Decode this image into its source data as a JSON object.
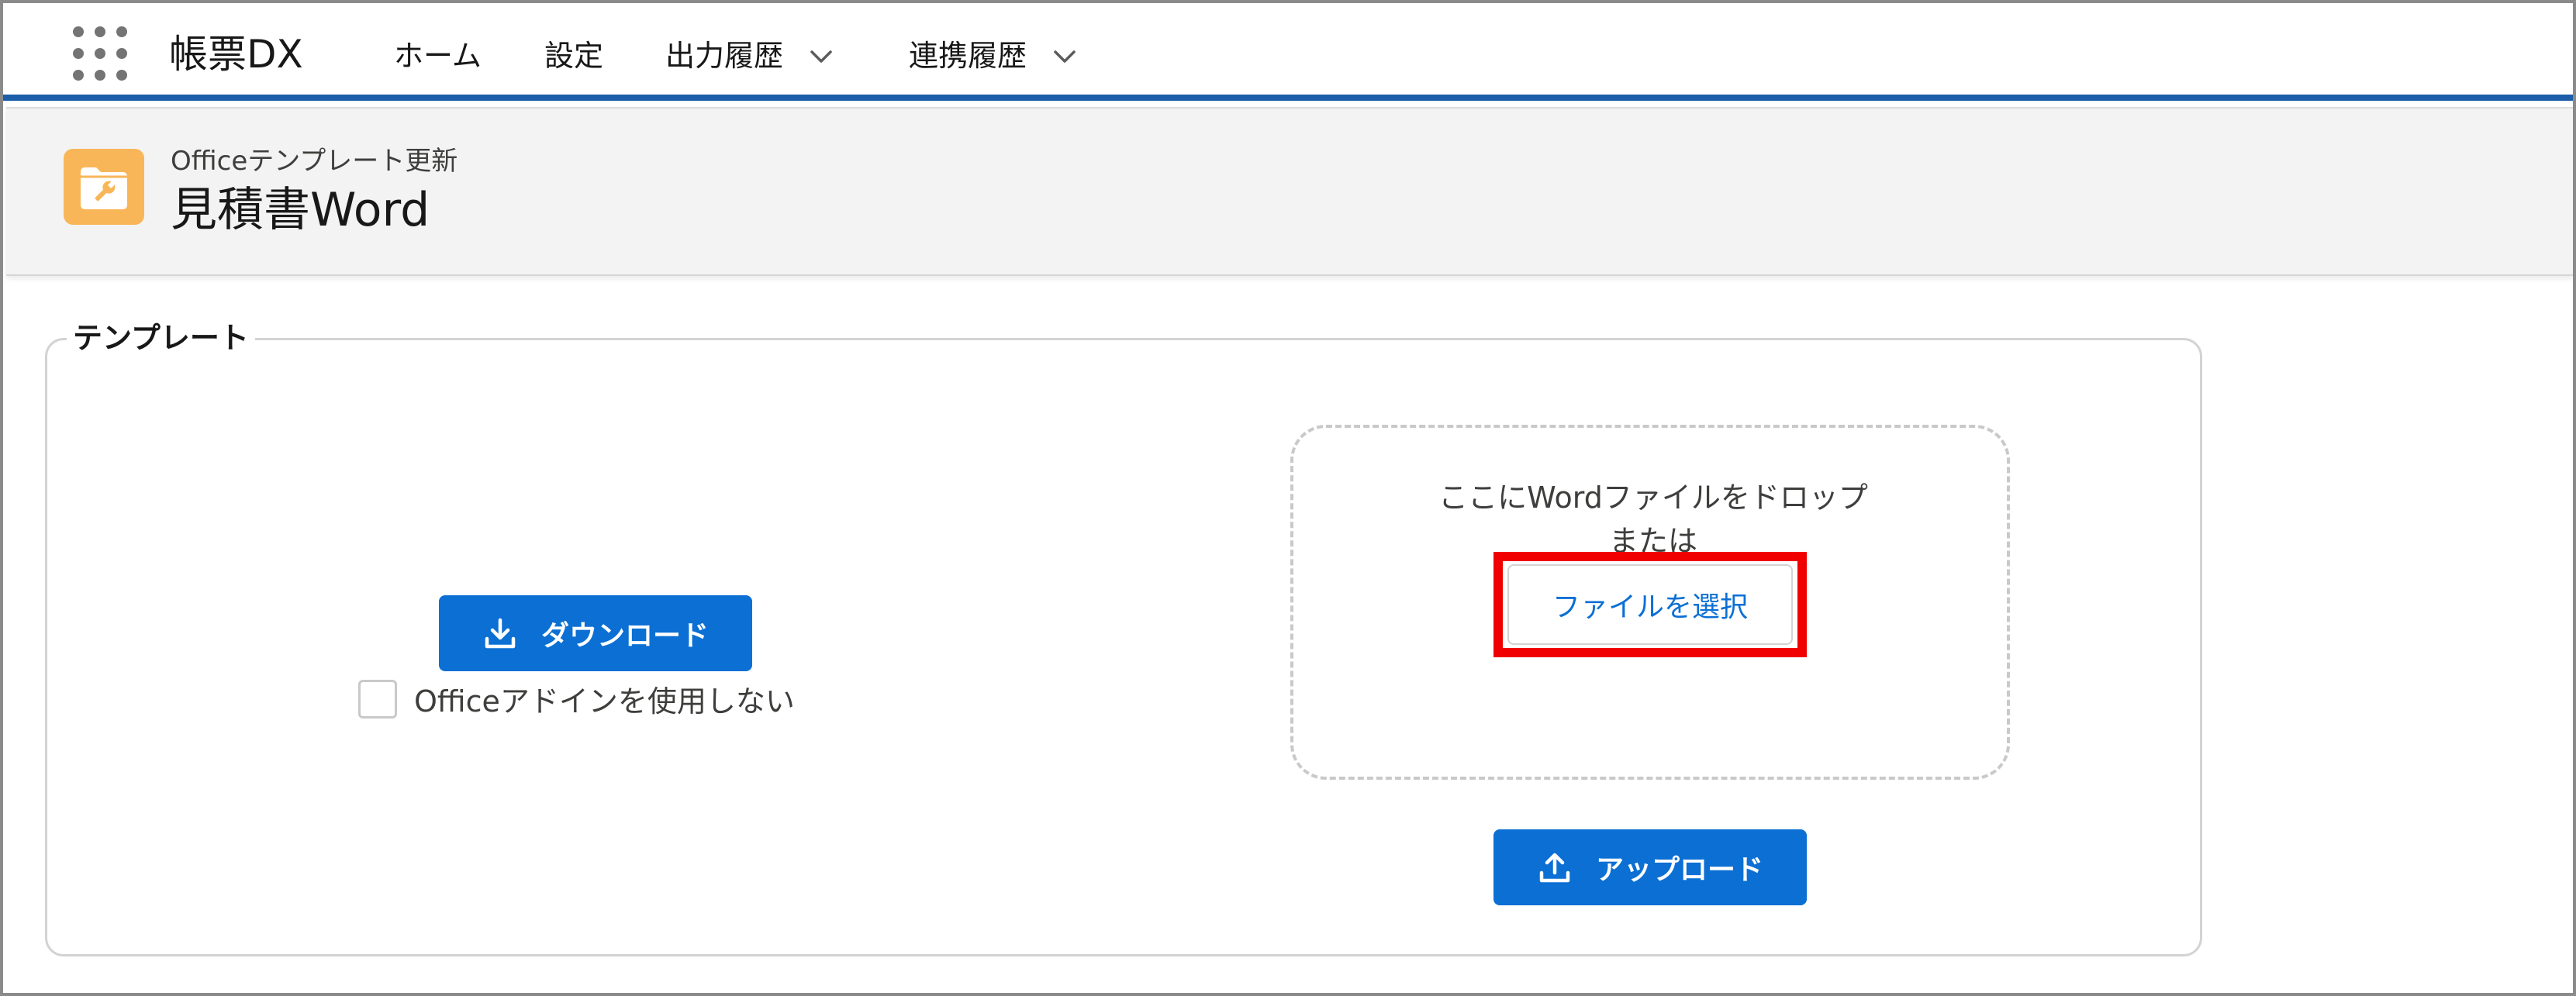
{
  "topnav": {
    "app_name": "帳票DX",
    "items": [
      {
        "label": "ホーム",
        "has_dropdown": false
      },
      {
        "label": "設定",
        "has_dropdown": false
      },
      {
        "label": "出力履歴",
        "has_dropdown": true
      },
      {
        "label": "連携履歴",
        "has_dropdown": true
      }
    ],
    "accent_color": "#1b5da8"
  },
  "header": {
    "object_type": "Officeテンプレート更新",
    "title": "見積書Word",
    "icon": "folder-wrench-icon",
    "icon_color": "#f9b658"
  },
  "template_section": {
    "legend": "テンプレート",
    "download_button": {
      "label": "ダウンロード",
      "icon": "download-icon"
    },
    "checkbox": {
      "label": "Officeアドインを使用しない",
      "checked": false
    },
    "dropzone": {
      "line1": "ここにWordファイルをドロップ",
      "line2": "または",
      "select_button": "ファイルを選択"
    },
    "upload_button": {
      "label": "アップロード",
      "icon": "upload-icon"
    },
    "brand_color": "#0b6fd4",
    "highlight_color": "#f00000"
  }
}
